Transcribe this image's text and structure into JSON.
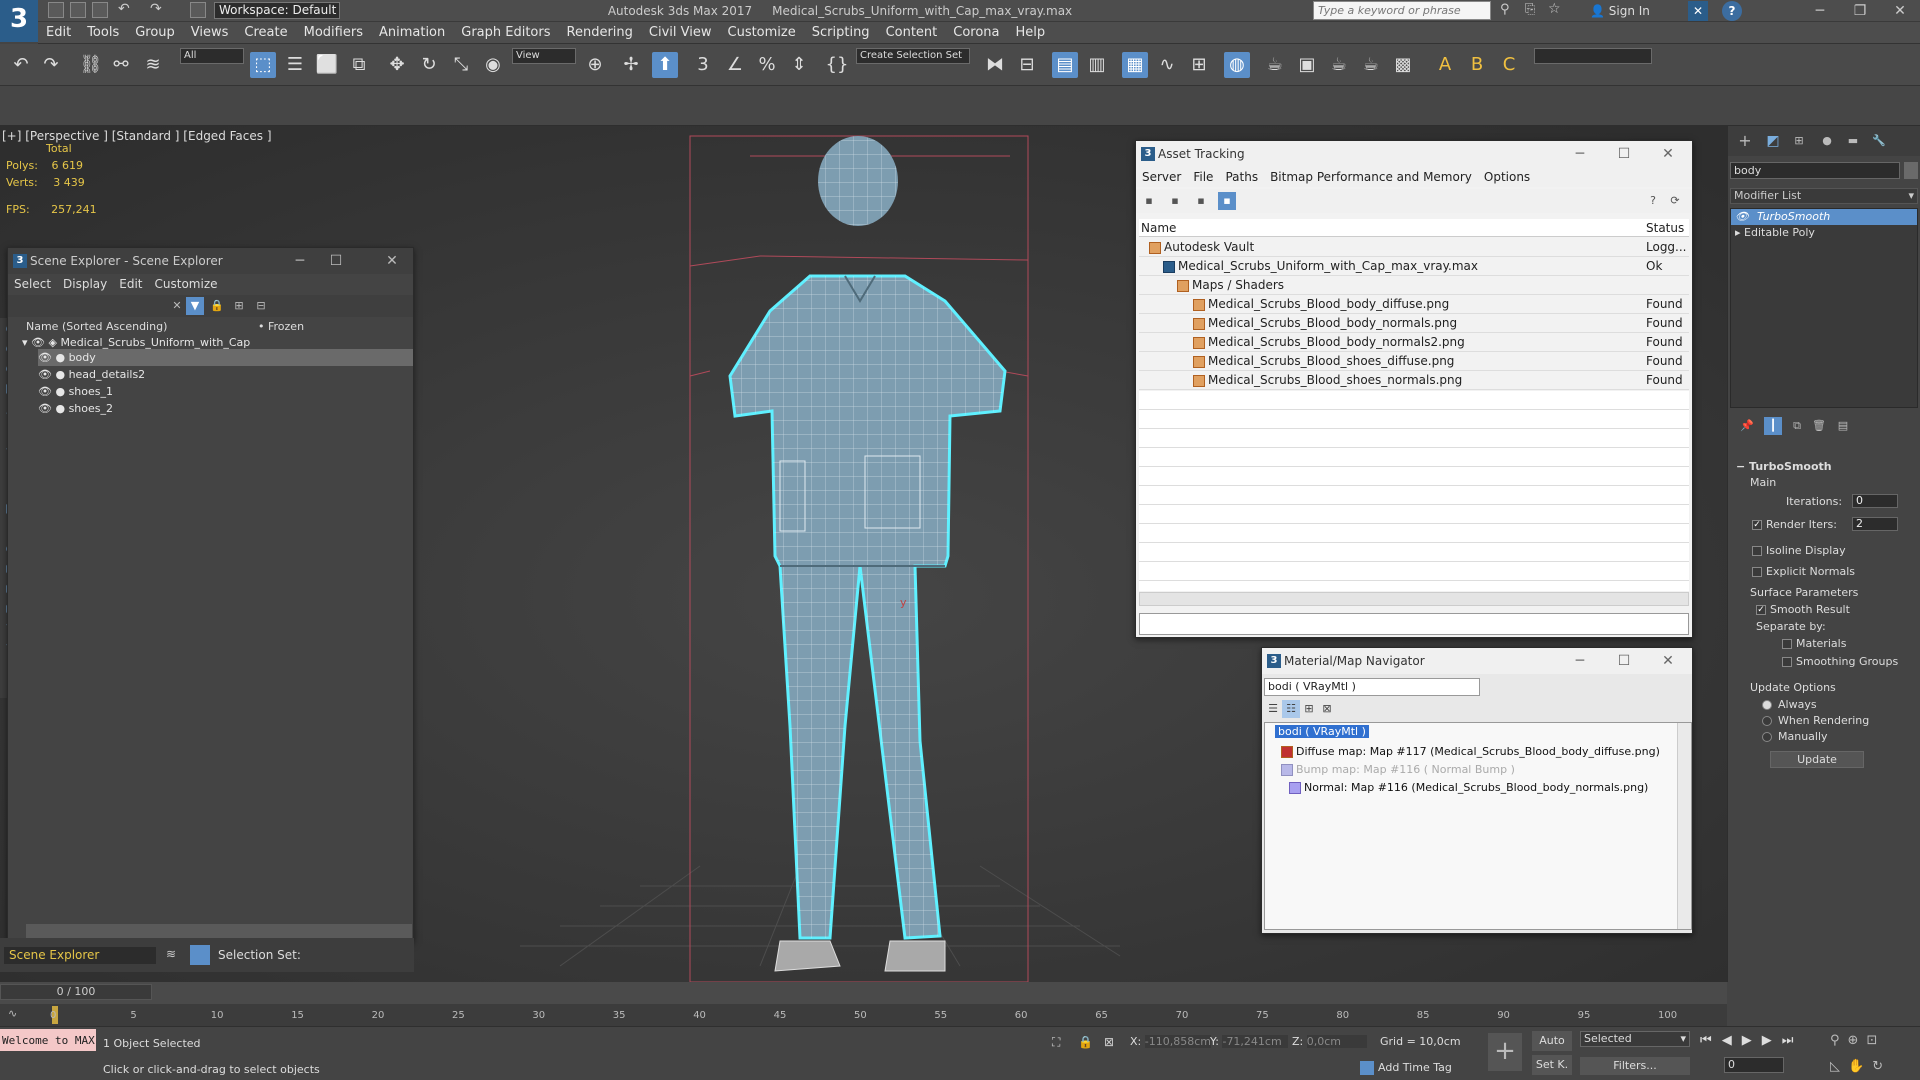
{
  "titlebar": {
    "workspace": "Workspace: Default",
    "app_name": "Autodesk 3ds Max 2017",
    "file_name": "Medical_Scrubs_Uniform_with_Cap_max_vray.max",
    "search_placeholder": "Type a keyword or phrase",
    "sign_in": "Sign In"
  },
  "menu": [
    "Edit",
    "Tools",
    "Group",
    "Views",
    "Create",
    "Modifiers",
    "Animation",
    "Graph Editors",
    "Rendering",
    "Civil View",
    "Customize",
    "Scripting",
    "Content",
    "Corona",
    "Help"
  ],
  "toolbar": {
    "filter": "All",
    "ref_coord": "View",
    "selection_set": "Create Selection Set"
  },
  "viewport": {
    "label": "[+] [Perspective ] [Standard ] [Edged Faces ]",
    "total": "Total",
    "polys_label": "Polys:",
    "polys": "6 619",
    "verts_label": "Verts:",
    "verts": "3 439",
    "fps_label": "FPS:",
    "fps": "257,241"
  },
  "scene_explorer": {
    "title": "Scene Explorer - Scene Explorer",
    "menu": [
      "Select",
      "Display",
      "Edit",
      "Customize"
    ],
    "col_name": "Name (Sorted Ascending)",
    "col_frozen": "• Frozen",
    "root": "Medical_Scrubs_Uniform_with_Cap",
    "items": [
      "body",
      "head_details2",
      "shoes_1",
      "shoes_2"
    ],
    "footer_name": "Scene Explorer",
    "selection_set": "Selection Set:"
  },
  "asset_tracking": {
    "title": "Asset Tracking",
    "menu": [
      "Server",
      "File",
      "Paths",
      "Bitmap Performance and Memory",
      "Options"
    ],
    "col_name": "Name",
    "col_status": "Status",
    "rows": [
      {
        "name": "Autodesk Vault",
        "status": "Logg..."
      },
      {
        "name": "Medical_Scrubs_Uniform_with_Cap_max_vray.max",
        "status": "Ok"
      },
      {
        "name": "Maps / Shaders",
        "status": ""
      },
      {
        "name": "Medical_Scrubs_Blood_body_diffuse.png",
        "status": "Found"
      },
      {
        "name": "Medical_Scrubs_Blood_body_normals.png",
        "status": "Found"
      },
      {
        "name": "Medical_Scrubs_Blood_body_normals2.png",
        "status": "Found"
      },
      {
        "name": "Medical_Scrubs_Blood_shoes_diffuse.png",
        "status": "Found"
      },
      {
        "name": "Medical_Scrubs_Blood_shoes_normals.png",
        "status": "Found"
      }
    ]
  },
  "material_navigator": {
    "title": "Material/Map Navigator",
    "current": "bodi  ( VRayMtl )",
    "tree": [
      "bodi  ( VRayMtl )",
      "Diffuse map: Map #117 (Medical_Scrubs_Blood_body_diffuse.png)",
      "Bump map: Map #116  ( Normal Bump )",
      "Normal: Map #116 (Medical_Scrubs_Blood_body_normals.png)"
    ]
  },
  "command_panel": {
    "object_name": "body",
    "modifier_list": "Modifier List",
    "stack": [
      "TurboSmooth",
      "Editable Poly"
    ],
    "rollout": "TurboSmooth",
    "main": "Main",
    "iterations_label": "Iterations:",
    "iterations": "0",
    "render_iters_label": "Render Iters:",
    "render_iters": "2",
    "isoline": "Isoline Display",
    "explicit_normals": "Explicit Normals",
    "surface_params": "Surface Parameters",
    "smooth_result": "Smooth Result",
    "separate_by": "Separate by:",
    "materials": "Materials",
    "smoothing_groups": "Smoothing Groups",
    "update_options": "Update Options",
    "always": "Always",
    "when_rendering": "When Rendering",
    "manually": "Manually",
    "update": "Update"
  },
  "timeline": {
    "frame": "0 / 100",
    "ticks": [
      "0",
      "5",
      "10",
      "15",
      "20",
      "25",
      "30",
      "35",
      "40",
      "45",
      "50",
      "55",
      "60",
      "65",
      "70",
      "75",
      "80",
      "85",
      "90",
      "95",
      "100"
    ]
  },
  "status": {
    "maxscript": "Welcome to MAX",
    "selected": "1 Object Selected",
    "prompt": "Click or click-and-drag to select objects",
    "x_label": "X:",
    "x": "-110,858cm",
    "y_label": "Y:",
    "y": "-71,241cm",
    "z_label": "Z:",
    "z": "0,0cm",
    "grid": "Grid = 10,0cm",
    "add_time_tag": "Add Time Tag",
    "auto": "Auto",
    "set_key": "Set K.",
    "key_mode": "Selected",
    "filters": "Filters...",
    "frame_field": "0"
  }
}
